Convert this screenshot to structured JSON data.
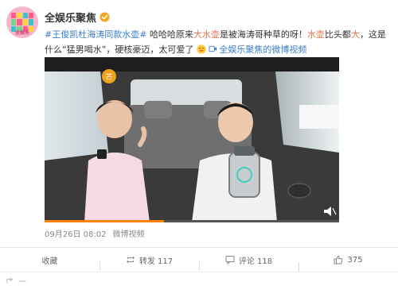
{
  "account": {
    "name": "全娱乐聚焦",
    "avatar_text": "全娱乐"
  },
  "post": {
    "hashtag": "#王俊凯杜海涛同款水壶#",
    "text_1": "哈哈哈原来",
    "hl_1": "大水壶",
    "text_2": "是被海涛哥种草的呀！",
    "hl_2": "水壶",
    "text_3": "比头都",
    "hl_3": "大",
    "text_4": "，这是什么“猛男喝水”，硬核豪迈，太可爱了",
    "link_text": "全娱乐聚焦的微博视频"
  },
  "meta": {
    "time": "09月26日 08:02",
    "source": "微博视频"
  },
  "actions": {
    "collect": "收藏",
    "repost": "转发 117",
    "comment": "评论 118",
    "like": "375"
  },
  "footer": {
    "hint": "一"
  },
  "colors": {
    "highlight": "#eb7350",
    "link": "#3b7ec6",
    "verified": "#f5a623"
  }
}
